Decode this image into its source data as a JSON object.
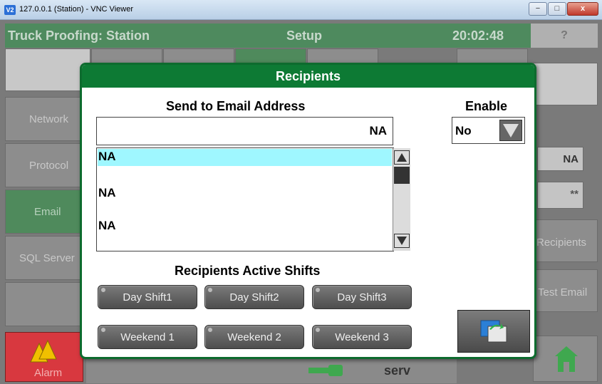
{
  "window": {
    "icon_text": "V2",
    "title": "127.0.0.1 (Station) - VNC Viewer",
    "minimize": "−",
    "maximize": "□",
    "close": "x"
  },
  "header": {
    "title": "Truck Proofing: Station",
    "screen": "Setup",
    "time": "20:02:48",
    "help": "?"
  },
  "side_menu": {
    "items": [
      "Network",
      "Protocol",
      "Email",
      "SQL Server"
    ],
    "alarm": "Alarm"
  },
  "right_panel": {
    "field1": "NA",
    "field2": "**",
    "recipients_button": "Recipients",
    "test_email_button": "Test Email"
  },
  "bottom": {
    "user": "serv"
  },
  "dialog": {
    "title": "Recipients",
    "email_label": "Send to Email Address",
    "email_value": "NA",
    "enable_label": "Enable",
    "enable_value": "No",
    "recipients": [
      "NA",
      "NA",
      "NA"
    ],
    "shifts_label": "Recipients Active Shifts",
    "shifts": [
      "Day Shift1",
      "Day Shift2",
      "Day Shift3",
      "Weekend 1",
      "Weekend 2",
      "Weekend 3"
    ]
  },
  "colors": {
    "header_green": "#4e8a5e",
    "dialog_green": "#0d7a34",
    "selected_row": "#9ff7ff"
  }
}
